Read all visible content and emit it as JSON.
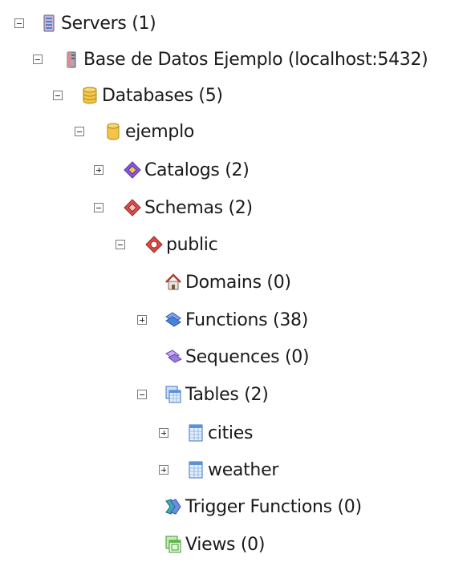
{
  "tree": {
    "servers": {
      "label": "Servers (1)",
      "icon": "servers-icon"
    },
    "server": {
      "label": "Base de Datos Ejemplo (localhost:5432)",
      "icon": "server-icon"
    },
    "databases": {
      "label": "Databases (5)",
      "icon": "databases-icon"
    },
    "database": {
      "label": "ejemplo",
      "icon": "database-icon"
    },
    "catalogs": {
      "label": "Catalogs (2)",
      "icon": "catalogs-icon"
    },
    "schemas": {
      "label": "Schemas (2)",
      "icon": "schemas-icon"
    },
    "public": {
      "label": "public",
      "icon": "schema-icon"
    },
    "domains": {
      "label": "Domains (0)",
      "icon": "domains-icon"
    },
    "functions": {
      "label": "Functions (38)",
      "icon": "functions-icon"
    },
    "sequences": {
      "label": "Sequences (0)",
      "icon": "sequences-icon"
    },
    "tables": {
      "label": "Tables (2)",
      "icon": "tables-icon"
    },
    "cities": {
      "label": "cities",
      "icon": "table-icon"
    },
    "weather": {
      "label": "weather",
      "icon": "table-icon"
    },
    "trigger_functions": {
      "label": "Trigger Functions (0)",
      "icon": "trigger-functions-icon"
    },
    "views": {
      "label": "Views (0)",
      "icon": "views-icon"
    }
  }
}
